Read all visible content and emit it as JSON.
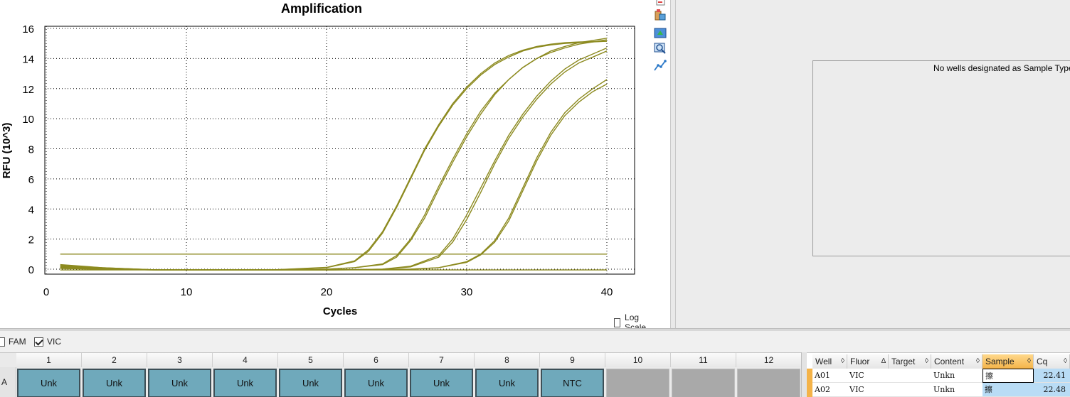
{
  "chart": {
    "title": "Amplification",
    "xlabel": "Cycles",
    "ylabel": "RFU (10^3)",
    "x_ticks": [
      "0",
      "10",
      "20",
      "30",
      "40"
    ],
    "y_ticks": [
      "0",
      "2",
      "4",
      "6",
      "8",
      "10",
      "12",
      "14",
      "16"
    ],
    "line_color": "#8c8a1f",
    "log_scale_label": "Log Scale",
    "log_scale_checked": false
  },
  "chart_data": {
    "type": "line",
    "title": "Amplification",
    "xlabel": "Cycles",
    "ylabel": "RFU (10^3)",
    "xlim": [
      0,
      42
    ],
    "ylim": [
      -0.6,
      16.2
    ],
    "grid": true,
    "threshold": 1.0,
    "series": [
      {
        "x": [
          1,
          4,
          8,
          12,
          16,
          20,
          22,
          23,
          24,
          25,
          26,
          27,
          28,
          29,
          30,
          31,
          32,
          33,
          34,
          35,
          36,
          37,
          38,
          39,
          40
        ],
        "values": [
          0.3,
          0.1,
          -0.05,
          -0.05,
          -0.05,
          0.1,
          0.5,
          1.2,
          2.4,
          4.1,
          6.0,
          7.9,
          9.5,
          10.9,
          12.0,
          12.9,
          13.6,
          14.1,
          14.5,
          14.75,
          14.9,
          15.0,
          15.05,
          15.1,
          15.15
        ]
      },
      {
        "x": [
          1,
          4,
          8,
          12,
          16,
          20,
          22,
          23,
          24,
          25,
          26,
          27,
          28,
          29,
          30,
          31,
          32,
          33,
          34,
          35,
          36,
          37,
          38,
          39,
          40
        ],
        "values": [
          0.25,
          0.1,
          -0.05,
          -0.05,
          -0.05,
          0.12,
          0.55,
          1.3,
          2.5,
          4.2,
          6.1,
          8.0,
          9.6,
          11.0,
          12.1,
          13.0,
          13.7,
          14.2,
          14.55,
          14.8,
          14.95,
          15.05,
          15.1,
          15.12,
          15.15
        ]
      },
      {
        "x": [
          1,
          4,
          8,
          12,
          16,
          20,
          22,
          24,
          25,
          26,
          27,
          28,
          29,
          30,
          31,
          32,
          33,
          34,
          35,
          36,
          37,
          38,
          39,
          40
        ],
        "values": [
          0.2,
          0.05,
          -0.05,
          -0.05,
          -0.05,
          0.0,
          0.1,
          0.35,
          0.9,
          2.0,
          3.6,
          5.5,
          7.3,
          9.0,
          10.5,
          11.7,
          12.6,
          13.4,
          14.0,
          14.4,
          14.7,
          14.95,
          15.1,
          15.25
        ]
      },
      {
        "x": [
          1,
          4,
          8,
          12,
          16,
          20,
          22,
          24,
          25,
          26,
          27,
          28,
          29,
          30,
          31,
          32,
          33,
          34,
          35,
          36,
          37,
          38,
          39,
          40
        ],
        "values": [
          0.15,
          0.05,
          -0.05,
          -0.05,
          -0.05,
          0.0,
          0.1,
          0.3,
          0.8,
          1.9,
          3.4,
          5.3,
          7.1,
          8.8,
          10.3,
          11.6,
          12.6,
          13.4,
          14.0,
          14.5,
          14.8,
          15.05,
          15.2,
          15.35
        ]
      },
      {
        "x": [
          1,
          4,
          8,
          12,
          16,
          20,
          24,
          26,
          28,
          29,
          30,
          31,
          32,
          33,
          34,
          35,
          36,
          37,
          38,
          39,
          40
        ],
        "values": [
          0.1,
          0.0,
          -0.05,
          -0.05,
          -0.05,
          -0.05,
          0.0,
          0.2,
          0.9,
          2.0,
          3.6,
          5.4,
          7.2,
          8.9,
          10.3,
          11.5,
          12.5,
          13.3,
          13.9,
          14.3,
          14.7
        ]
      },
      {
        "x": [
          1,
          4,
          8,
          12,
          16,
          20,
          24,
          26,
          28,
          29,
          30,
          31,
          32,
          33,
          34,
          35,
          36,
          37,
          38,
          39,
          40
        ],
        "values": [
          0.1,
          0.0,
          -0.05,
          -0.05,
          -0.05,
          -0.05,
          0.0,
          0.15,
          0.8,
          1.8,
          3.3,
          5.1,
          7.0,
          8.7,
          10.1,
          11.3,
          12.3,
          13.1,
          13.7,
          14.1,
          14.5
        ]
      },
      {
        "x": [
          1,
          4,
          8,
          12,
          16,
          20,
          26,
          28,
          30,
          31,
          32,
          33,
          34,
          35,
          36,
          37,
          38,
          39,
          40
        ],
        "values": [
          0.05,
          0.0,
          -0.05,
          -0.05,
          -0.05,
          -0.05,
          0.0,
          0.1,
          0.5,
          1.0,
          1.9,
          3.4,
          5.4,
          7.4,
          9.1,
          10.4,
          11.3,
          12.0,
          12.6
        ]
      },
      {
        "x": [
          1,
          4,
          8,
          12,
          16,
          20,
          26,
          28,
          30,
          31,
          32,
          33,
          34,
          35,
          36,
          37,
          38,
          39,
          40
        ],
        "values": [
          0.05,
          0.0,
          -0.05,
          -0.05,
          -0.05,
          -0.05,
          0.0,
          0.1,
          0.45,
          0.95,
          1.8,
          3.2,
          5.2,
          7.2,
          8.9,
          10.2,
          11.1,
          11.8,
          12.3
        ]
      },
      {
        "x": [
          1,
          40
        ],
        "values": [
          1.0,
          1.0
        ]
      },
      {
        "x": [
          1,
          40
        ],
        "values": [
          -0.05,
          -0.05
        ]
      }
    ]
  },
  "toolbar": {
    "icons": [
      "copy-icon",
      "export-icon",
      "refresh-icon",
      "zoom-icon",
      "trace-icon"
    ]
  },
  "right_panel": {
    "message": "No wells designated as Sample Type sta"
  },
  "fluor": {
    "fam_label": "FAM",
    "fam_checked": false,
    "vic_label": "VIC",
    "vic_checked": true
  },
  "plate": {
    "row_label": "A",
    "columns": [
      "1",
      "2",
      "3",
      "4",
      "5",
      "6",
      "7",
      "8",
      "9",
      "10",
      "11",
      "12"
    ],
    "wells": [
      "Unk",
      "Unk",
      "Unk",
      "Unk",
      "Unk",
      "Unk",
      "Unk",
      "Unk",
      "NTC",
      "",
      "",
      ""
    ]
  },
  "results": {
    "headers": [
      "Well",
      "Fluor",
      "Target",
      "Content",
      "Sample",
      "Cq"
    ],
    "sort_marks": [
      "◊",
      "∆",
      "◊",
      "◊",
      "◊",
      "◊"
    ],
    "rows": [
      {
        "well": "A01",
        "fluor": "VIC",
        "target": "",
        "content": "Unkn",
        "sample": "擦",
        "cq": "22.41"
      },
      {
        "well": "A02",
        "fluor": "VIC",
        "target": "",
        "content": "Unkn",
        "sample": "擦",
        "cq": "22.48"
      }
    ]
  }
}
